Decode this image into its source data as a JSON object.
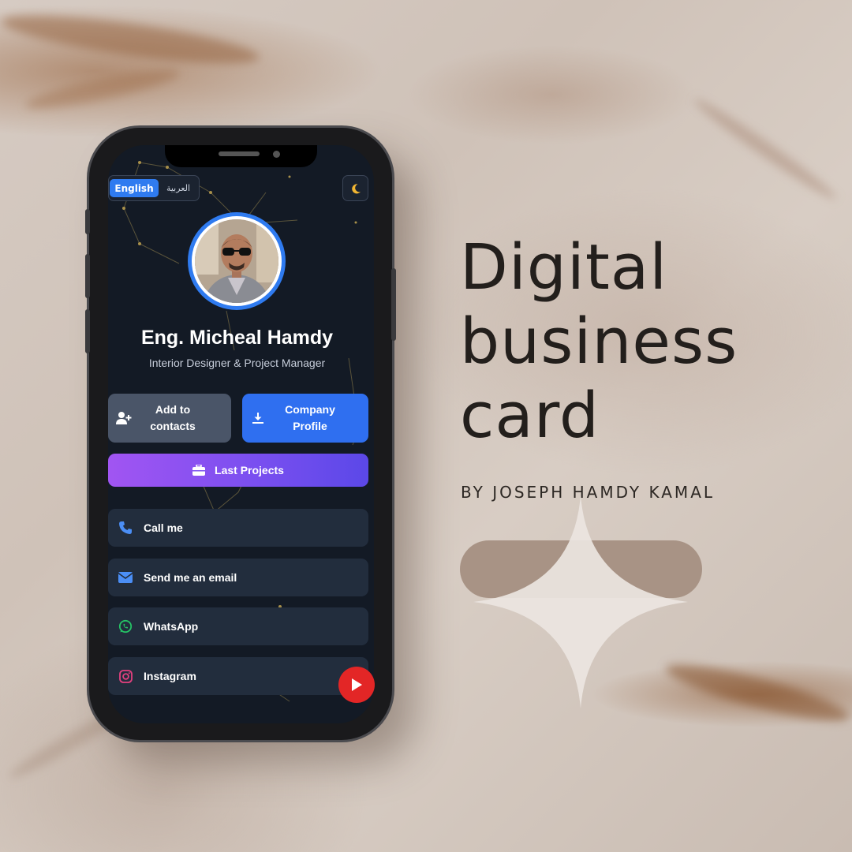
{
  "phone": {
    "language": {
      "english": "English",
      "arabic": "العربية"
    },
    "theme_icon": "moon-icon",
    "profile": {
      "name": "Eng. Micheal Hamdy",
      "role": "Interior Designer & Project Manager"
    },
    "buttons": {
      "add_contacts": "Add to contacts",
      "company_profile": "Company Profile",
      "last_projects": "Last Projects"
    },
    "links": [
      {
        "label": "Call me",
        "icon": "phone-icon"
      },
      {
        "label": "Send me an email",
        "icon": "envelope-icon"
      },
      {
        "label": "WhatsApp",
        "icon": "whatsapp-icon"
      },
      {
        "label": "Instagram",
        "icon": "instagram-icon"
      }
    ],
    "play_icon": "play-icon"
  },
  "promo": {
    "title_line1": "Digital",
    "title_line2": "business",
    "title_line3": "card",
    "byline": "BY JOSEPH HAMDY KAMAL"
  },
  "colors": {
    "accent_blue": "#2f6ff0",
    "purple": "#8b52f0",
    "screen_bg": "#131a25",
    "youtube_red": "#e32626"
  }
}
